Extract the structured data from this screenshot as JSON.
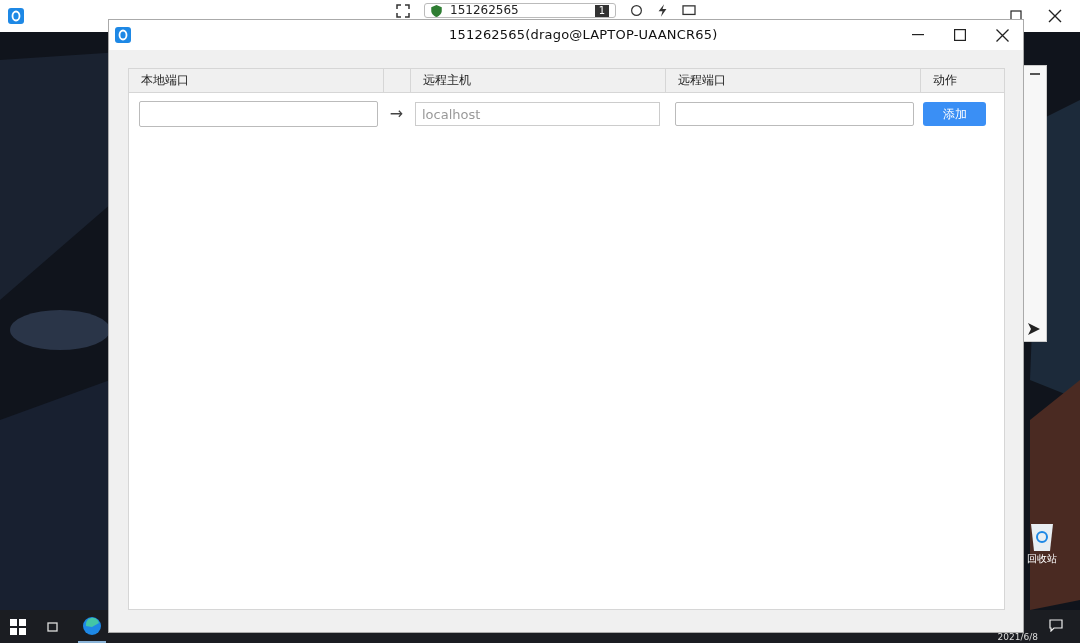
{
  "remote_bar": {
    "session_id": "151262565",
    "monitor": "1"
  },
  "window": {
    "title": "151262565(drago@LAPTOP-UAANCR65)"
  },
  "table": {
    "columns": [
      "本地端口",
      "远程主机",
      "远程端口",
      "动作"
    ],
    "row": {
      "arrow": "→",
      "remote_host": {
        "placeholder": "localhost"
      },
      "button": "添加"
    }
  },
  "desktop": {
    "icons": [
      {
        "label": "回收站"
      }
    ]
  },
  "taskbar": {
    "date": "2021/6/8"
  }
}
